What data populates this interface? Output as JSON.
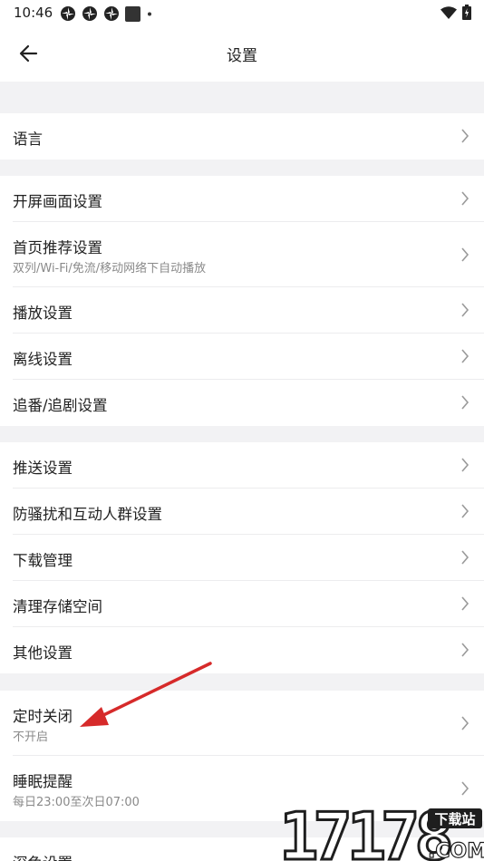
{
  "status": {
    "time": "10:46"
  },
  "header": {
    "title": "设置"
  },
  "items": [
    {
      "label": "语言"
    },
    {
      "label": "开屏画面设置"
    },
    {
      "label": "首页推荐设置",
      "sub": "双列/Wi-Fi/免流/移动网络下自动播放"
    },
    {
      "label": "播放设置"
    },
    {
      "label": "离线设置"
    },
    {
      "label": "追番/追剧设置"
    },
    {
      "label": "推送设置"
    },
    {
      "label": "防骚扰和互动人群设置"
    },
    {
      "label": "下载管理"
    },
    {
      "label": "清理存储空间"
    },
    {
      "label": "其他设置"
    },
    {
      "label": "定时关闭",
      "sub": "不开启"
    },
    {
      "label": "睡眠提醒",
      "sub": "每日23:00至次日07:00"
    },
    {
      "label": "深色设置"
    }
  ],
  "watermark": {
    "text": "17178",
    "tag": "下载站",
    "suffix": ".COM"
  },
  "colors": {
    "annotation_arrow": "#d62a2a",
    "background": "#f2f2f4",
    "watermark": "#1e1e1e"
  }
}
